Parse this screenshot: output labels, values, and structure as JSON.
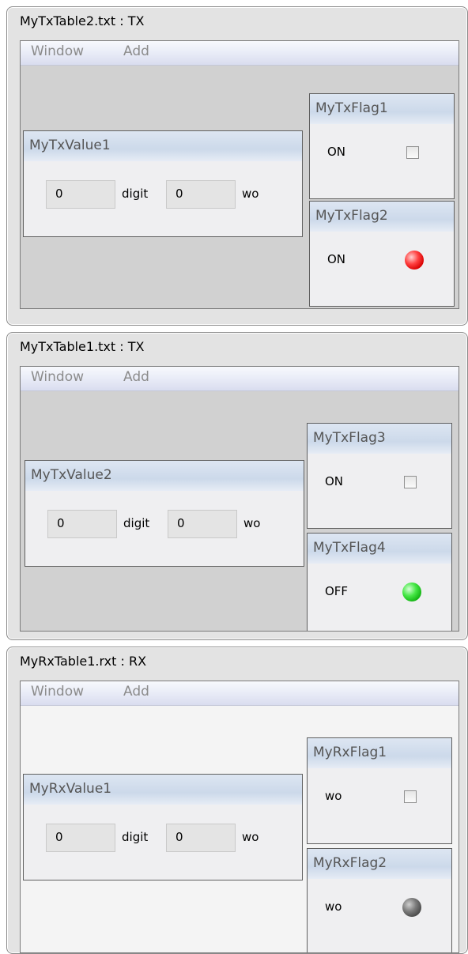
{
  "windows": [
    {
      "title": "MyTxTable2.txt : TX",
      "menu": {
        "window": "Window",
        "add": "Add"
      },
      "value_panel": {
        "title": "MyTxValue1",
        "digit_value": "0",
        "digit_unit": "digit",
        "wo_value": "0",
        "wo_unit": "wo"
      },
      "flags": [
        {
          "title": "MyTxFlag1",
          "text": "ON",
          "control": "checkbox"
        },
        {
          "title": "MyTxFlag2",
          "text": "ON",
          "control": "led",
          "led_color": "red"
        }
      ]
    },
    {
      "title": "MyTxTable1.txt : TX",
      "menu": {
        "window": "Window",
        "add": "Add"
      },
      "value_panel": {
        "title": "MyTxValue2",
        "digit_value": "0",
        "digit_unit": "digit",
        "wo_value": "0",
        "wo_unit": "wo"
      },
      "flags": [
        {
          "title": "MyTxFlag3",
          "text": "ON",
          "control": "checkbox"
        },
        {
          "title": "MyTxFlag4",
          "text": "OFF",
          "control": "led",
          "led_color": "green"
        }
      ]
    },
    {
      "title": "MyRxTable1.rxt : RX",
      "menu": {
        "window": "Window",
        "add": "Add"
      },
      "value_panel": {
        "title": "MyRxValue1",
        "digit_value": "0",
        "digit_unit": "digit",
        "wo_value": "0",
        "wo_unit": "wo"
      },
      "flags": [
        {
          "title": "MyRxFlag1",
          "text": "wo",
          "control": "checkbox"
        },
        {
          "title": "MyRxFlag2",
          "text": "wo",
          "control": "led",
          "led_color": "gray"
        }
      ]
    }
  ]
}
